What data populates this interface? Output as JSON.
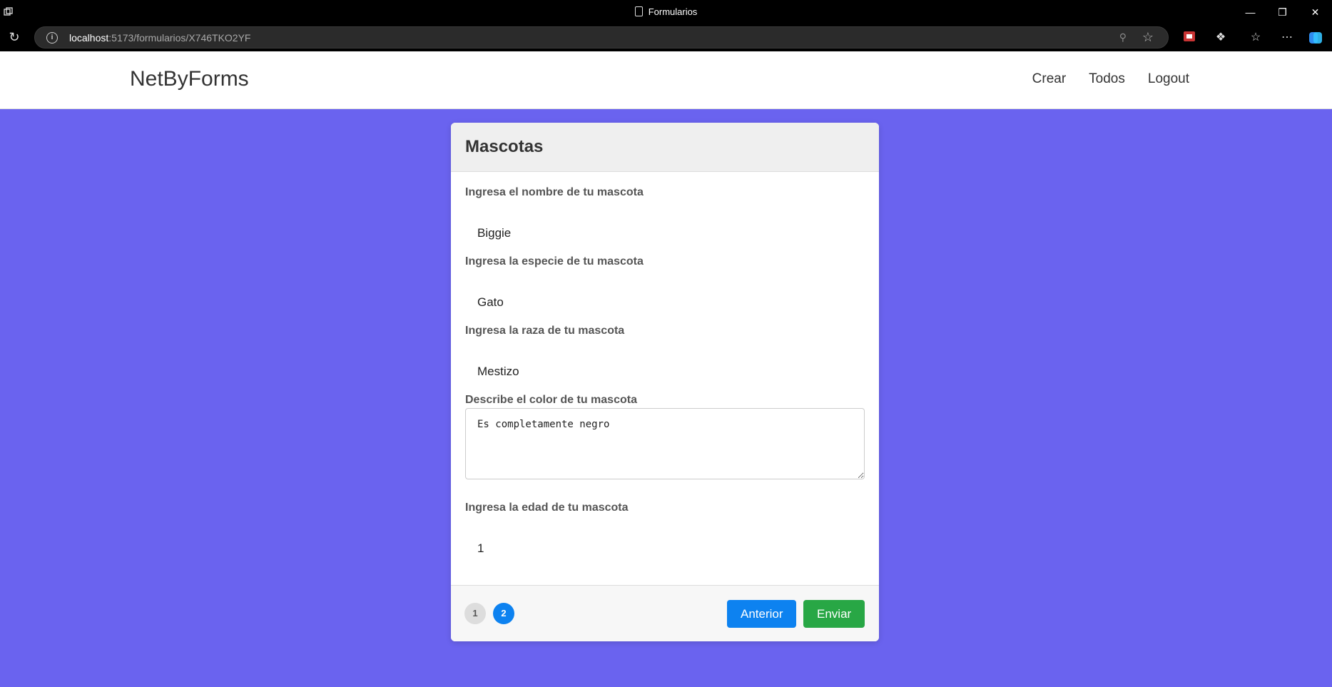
{
  "browser": {
    "window_title": "Formularios",
    "url_host": "localhost",
    "url_path": ":5173/formularios/X746TKO2YF"
  },
  "nav": {
    "brand": "NetByForms",
    "links": [
      "Crear",
      "Todos",
      "Logout"
    ]
  },
  "form": {
    "title": "Mascotas",
    "fields": [
      {
        "label": "Ingresa el nombre de tu mascota",
        "value": "Biggie"
      },
      {
        "label": "Ingresa la especie de tu mascota",
        "value": "Gato"
      },
      {
        "label": "Ingresa la raza de tu mascota",
        "value": "Mestizo"
      },
      {
        "label": "Describe el color de tu mascota",
        "value": "Es completamente negro"
      },
      {
        "label": "Ingresa la edad de tu mascota",
        "value": "1"
      }
    ],
    "steps": [
      "1",
      "2"
    ],
    "active_step": "2",
    "prev_label": "Anterior",
    "submit_label": "Enviar"
  },
  "colors": {
    "background": "#6a63ef",
    "primary": "#0d82f0",
    "success": "#28a745"
  }
}
